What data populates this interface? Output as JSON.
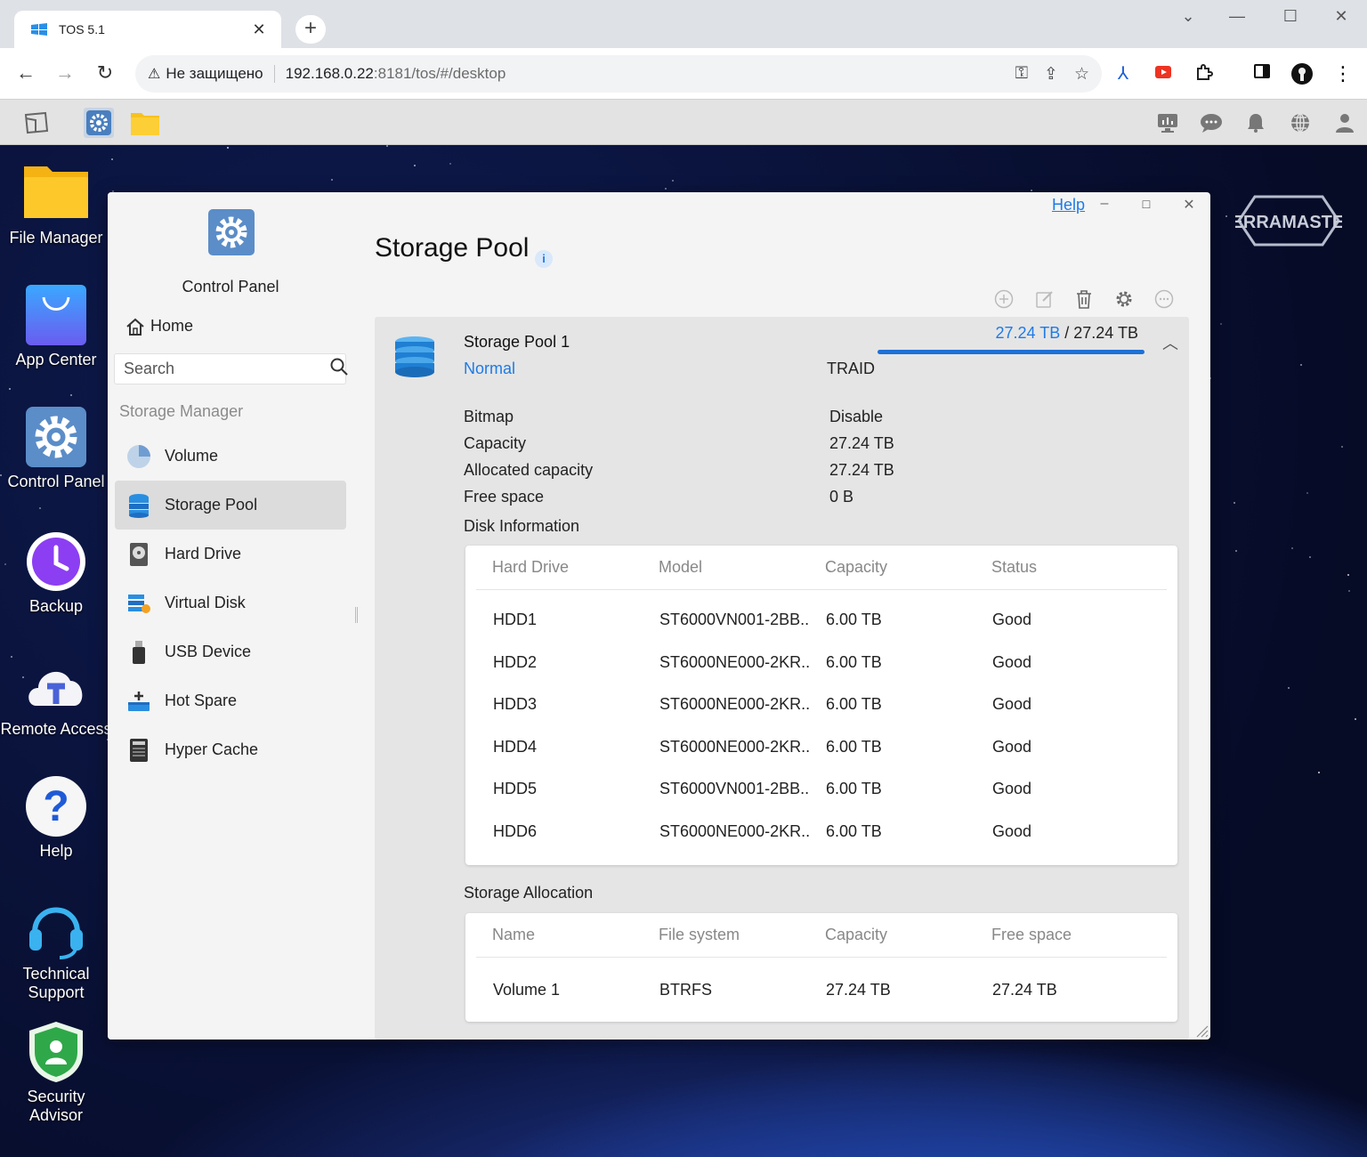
{
  "browser": {
    "tab_title": "TOS 5.1",
    "security_label": "Не защищено",
    "url_host": "192.168.0.22",
    "url_rest": ":8181/tos/#/desktop"
  },
  "desktop": {
    "icons": [
      {
        "label": "File Manager"
      },
      {
        "label": "App Center"
      },
      {
        "label": "Control Panel"
      },
      {
        "label": "Backup"
      },
      {
        "label": "Remote Access"
      },
      {
        "label": "Help"
      },
      {
        "label": "Technical Support"
      },
      {
        "label": "Security Advisor"
      }
    ],
    "brand": "TERRAMASTER"
  },
  "window": {
    "help": "Help",
    "sidebar": {
      "app_title": "Control Panel",
      "home": "Home",
      "search_placeholder": "Search",
      "group": "Storage Manager",
      "items": [
        {
          "label": "Volume"
        },
        {
          "label": "Storage Pool"
        },
        {
          "label": "Hard Drive"
        },
        {
          "label": "Virtual Disk"
        },
        {
          "label": "USB Device"
        },
        {
          "label": "Hot Spare"
        },
        {
          "label": "Hyper Cache"
        }
      ]
    },
    "page_title": "Storage Pool",
    "pool": {
      "name": "Storage Pool 1",
      "status": "Normal",
      "raid": "TRAID",
      "used": "27.24 TB",
      "separator": "/",
      "total": "27.24 TB",
      "usage_fraction": 1.0,
      "props": [
        {
          "label": "Bitmap",
          "value": "Disable"
        },
        {
          "label": "Capacity",
          "value": "27.24 TB"
        },
        {
          "label": "Allocated capacity",
          "value": "27.24 TB"
        },
        {
          "label": "Free space",
          "value": "0 B"
        }
      ],
      "disk_section": "Disk Information",
      "disk_columns": [
        "Hard Drive",
        "Model",
        "Capacity",
        "Status"
      ],
      "disks": [
        [
          "HDD1",
          "ST6000VN001-2BB...",
          "6.00 TB",
          "Good"
        ],
        [
          "HDD2",
          "ST6000NE000-2KR...",
          "6.00 TB",
          "Good"
        ],
        [
          "HDD3",
          "ST6000NE000-2KR...",
          "6.00 TB",
          "Good"
        ],
        [
          "HDD4",
          "ST6000NE000-2KR...",
          "6.00 TB",
          "Good"
        ],
        [
          "HDD5",
          "ST6000VN001-2BB...",
          "6.00 TB",
          "Good"
        ],
        [
          "HDD6",
          "ST6000NE000-2KR...",
          "6.00 TB",
          "Good"
        ]
      ],
      "alloc_section": "Storage Allocation",
      "alloc_columns": [
        "Name",
        "File system",
        "Capacity",
        "Free space"
      ],
      "alloc_rows": [
        [
          "Volume 1",
          "BTRFS",
          "27.24 TB",
          "27.24 TB"
        ]
      ]
    }
  },
  "colors": {
    "accent": "#1e7be6",
    "folder": "#f8c21c"
  }
}
